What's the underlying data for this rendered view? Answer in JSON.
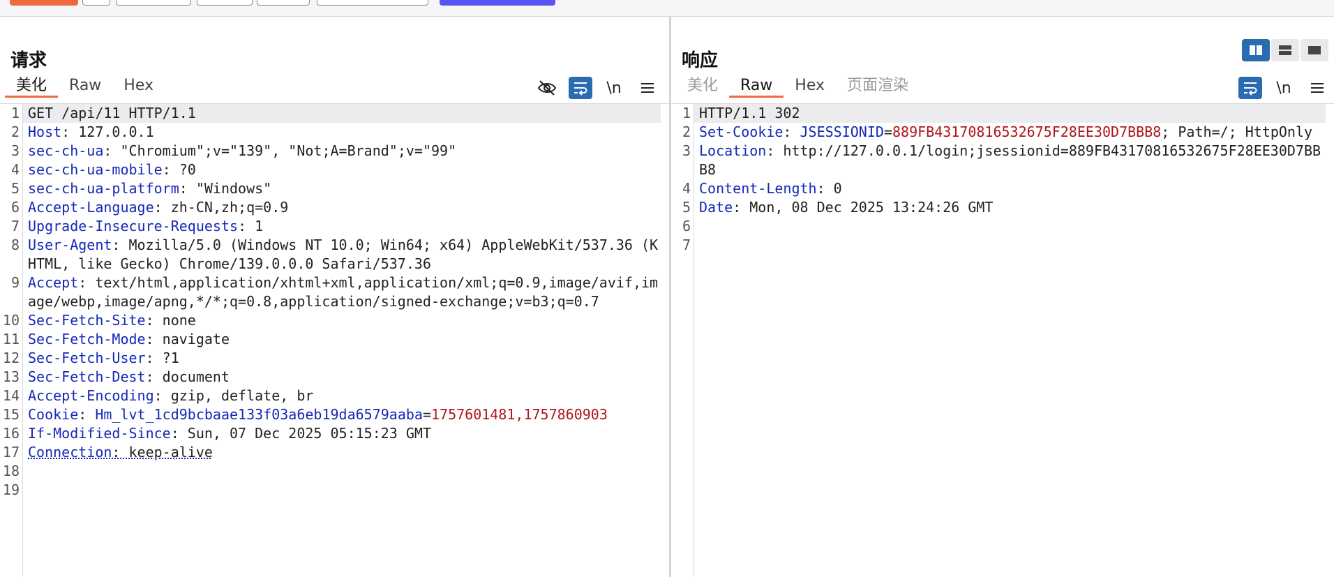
{
  "request": {
    "title": "请求",
    "tabs": [
      {
        "label": "美化",
        "active": true
      },
      {
        "label": "Raw",
        "active": false
      },
      {
        "label": "Hex",
        "active": false
      }
    ],
    "tools": {
      "newline_label": "\\n"
    },
    "lines": [
      {
        "n": "1",
        "name": "",
        "text": "GET /api/11 HTTP/1.1"
      },
      {
        "n": "2",
        "name": "Host",
        "value": "127.0.0.1"
      },
      {
        "n": "3",
        "name": "sec-ch-ua",
        "value": "\"Chromium\";v=\"139\", \"Not;A=Brand\";v=\"99\""
      },
      {
        "n": "4",
        "name": "sec-ch-ua-mobile",
        "value": "?0"
      },
      {
        "n": "5",
        "name": "sec-ch-ua-platform",
        "value": "\"Windows\""
      },
      {
        "n": "6",
        "name": "Accept-Language",
        "value": "zh-CN,zh;q=0.9"
      },
      {
        "n": "7",
        "name": "Upgrade-Insecure-Requests",
        "value": "1"
      },
      {
        "n": "8",
        "name": "User-Agent",
        "value": "Mozilla/5.0 (Windows NT 10.0; Win64; x64) AppleWebKit/537.36 (KHTML, like Gecko) Chrome/139.0.0.0 Safari/537.36"
      },
      {
        "n": "9",
        "name": "Accept",
        "value": "text/html,application/xhtml+xml,application/xml;q=0.9,image/avif,image/webp,image/apng,*/*;q=0.8,application/signed-exchange;v=b3;q=0.7"
      },
      {
        "n": "10",
        "name": "Sec-Fetch-Site",
        "value": "none"
      },
      {
        "n": "11",
        "name": "Sec-Fetch-Mode",
        "value": "navigate"
      },
      {
        "n": "12",
        "name": "Sec-Fetch-User",
        "value": "?1"
      },
      {
        "n": "13",
        "name": "Sec-Fetch-Dest",
        "value": "document"
      },
      {
        "n": "14",
        "name": "Accept-Encoding",
        "value": "gzip, deflate, br"
      },
      {
        "n": "15",
        "name": "Cookie",
        "cookie_name": "Hm_lvt_1cd9bcbaae133f03a6eb19da6579aaba",
        "cookie_value": "1757601481,1757860903"
      },
      {
        "n": "16",
        "name": "If-Modified-Since",
        "value": "Sun, 07 Dec 2025 05:15:23 GMT"
      },
      {
        "n": "17",
        "name": "Connection",
        "value": "keep-alive"
      },
      {
        "n": "18",
        "text": ""
      },
      {
        "n": "19",
        "text": ""
      }
    ]
  },
  "response": {
    "title": "响应",
    "tabs": [
      {
        "label": "美化",
        "active": false
      },
      {
        "label": "Raw",
        "active": true
      },
      {
        "label": "Hex",
        "active": false
      },
      {
        "label": "页面渲染",
        "active": false
      }
    ],
    "tools": {
      "newline_label": "\\n"
    },
    "lines": [
      {
        "n": "1",
        "text": "HTTP/1.1 302"
      },
      {
        "n": "2",
        "name": "Set-Cookie",
        "cookie_name": "JSESSIONID",
        "cookie_value": "889FB43170816532675F28EE30D7BBB8",
        "suffix": "; Path=/; HttpOnly"
      },
      {
        "n": "3",
        "name": "Location",
        "value": "http://127.0.0.1/login;jsessionid=889FB43170816532675F28EE30D7BBB8"
      },
      {
        "n": "4",
        "name": "Content-Length",
        "value": "0"
      },
      {
        "n": "5",
        "name": "Date",
        "value": "Mon, 08 Dec 2025 13:24:26 GMT"
      },
      {
        "n": "6",
        "text": ""
      },
      {
        "n": "7",
        "text": ""
      }
    ]
  },
  "colors": {
    "accent_tab": "#ef6a3a",
    "header_name": "#1428b8",
    "cookie_value": "#b0151a",
    "toggle_on": "#2b6cb0",
    "primary_button": "#5b54f5"
  }
}
